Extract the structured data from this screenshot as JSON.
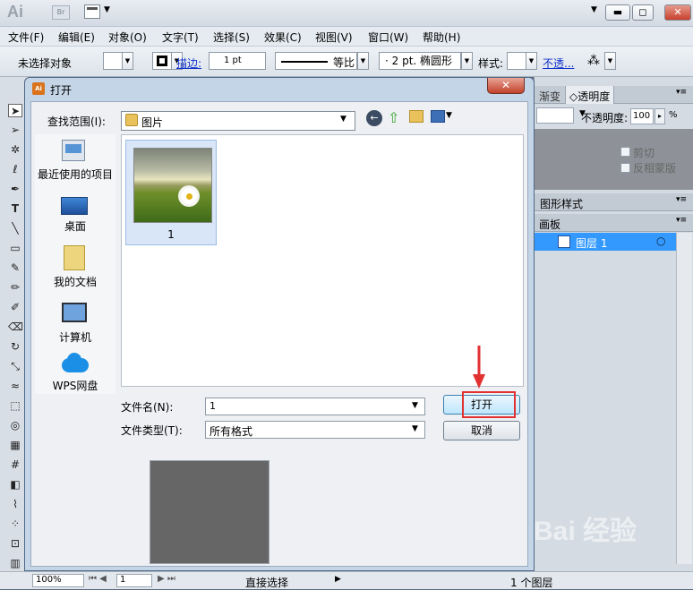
{
  "app": {
    "logo": "Ai",
    "bridge": "Br",
    "win_min": "▬",
    "win_max": "◻",
    "win_close": "✕",
    "ws_arrow": "▼"
  },
  "menu": [
    "文件(F)",
    "编辑(E)",
    "对象(O)",
    "文字(T)",
    "选择(S)",
    "效果(C)",
    "视图(V)",
    "窗口(W)",
    "帮助(H)"
  ],
  "control": {
    "selection": "未选择对象",
    "stroke_label": "描边:",
    "stroke_value": "1 pt",
    "profile": "等比",
    "brush": "2 pt. 椭圆形",
    "style_label": "样式:",
    "opacity_link": "不透..."
  },
  "panels": {
    "tab_gradient": "渐变",
    "tab_transparency": "透明度",
    "opacity_label": "不透明度:",
    "opacity_value": "100",
    "opacity_unit": "%",
    "clip": "剪切",
    "invert_mask": "反相蒙版",
    "graphic_styles": "图形样式",
    "artboard": "画板",
    "layer_name": "图层 1"
  },
  "status": {
    "zoom": "100%",
    "page": "1",
    "tool": "直接选择",
    "layers": "1 个图层"
  },
  "dialog": {
    "title": "打开",
    "title_icon": "Ai",
    "close": "✕",
    "lookin_label": "查找范围(I):",
    "lookin_value": "图片",
    "places": [
      "最近使用的项目",
      "桌面",
      "我的文档",
      "计算机",
      "WPS网盘"
    ],
    "file": {
      "name": "1"
    },
    "filename_label": "文件名(N):",
    "filename_value": "1",
    "filetype_label": "文件类型(T):",
    "filetype_value": "所有格式",
    "open_button": "打开",
    "cancel_button": "取消"
  },
  "watermark": "Bai 经验",
  "colors": {
    "accent": "#3399ff",
    "highlight": "#e23131",
    "arrow": "#e23131"
  }
}
